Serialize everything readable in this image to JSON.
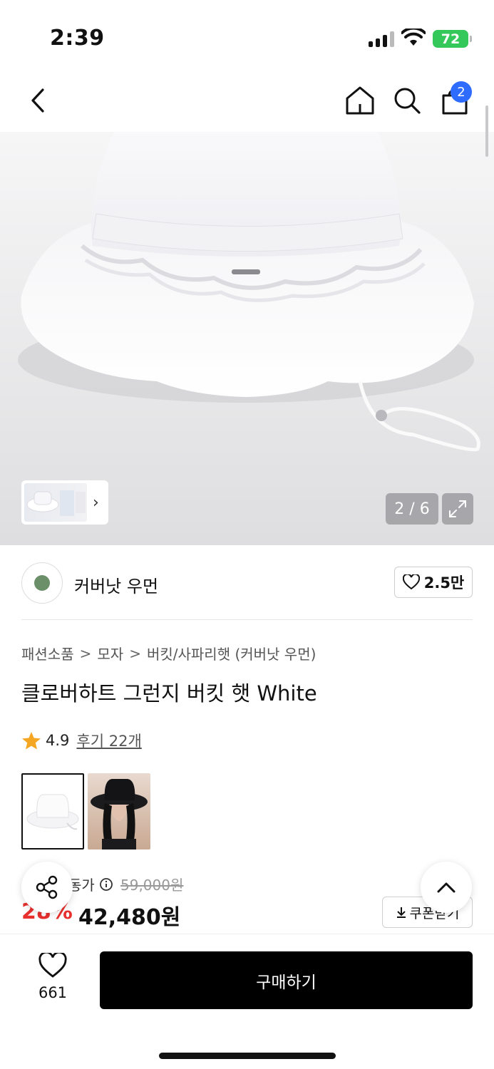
{
  "status_bar": {
    "time": "2:39",
    "battery": "72"
  },
  "nav": {
    "cart_badge": "2"
  },
  "gallery": {
    "page_counter": "2 / 6"
  },
  "brand": {
    "name": "커버낫 우먼",
    "likes": "2.5만"
  },
  "breadcrumb": {
    "items": [
      "패션소품",
      "모자",
      "버킷/사파리햇 (커버낫 우먼)"
    ],
    "separator": ">"
  },
  "product": {
    "title": "클로버하트 그런지 버킷 햇 White",
    "rating": "4.9",
    "reviews_label": "후기 22개"
  },
  "price": {
    "label": "정가",
    "label_visible": "동가",
    "original": "59,000원",
    "discount": "28%",
    "final": "42,480원",
    "coupon_label": "쿠폰받기"
  },
  "bottom_bar": {
    "wish_count": "661",
    "buy_label": "구매하기"
  },
  "colors": {
    "accent_blue": "#2e6bff",
    "discount_red": "#e8302e",
    "battery_green": "#34c759"
  },
  "icons": [
    "back-icon",
    "home-icon",
    "search-icon",
    "bag-icon",
    "expand-icon",
    "heart-icon",
    "star-icon",
    "info-icon",
    "download-icon",
    "share-icon",
    "chevron-up-icon"
  ]
}
